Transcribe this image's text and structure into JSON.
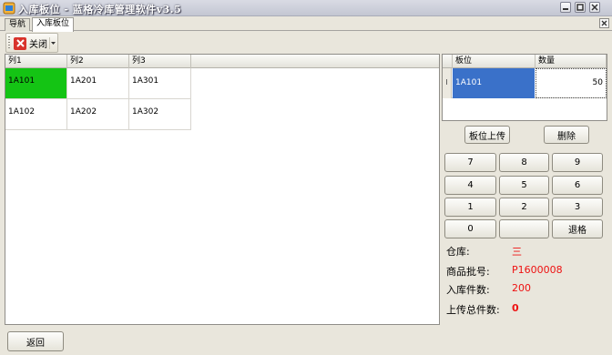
{
  "window": {
    "title": "入库板位 - 蓝格冷库管理软件v3.5"
  },
  "tabs": [
    {
      "label": "导航"
    },
    {
      "label": "入库板位"
    }
  ],
  "toolbar": {
    "close_label": "关闭"
  },
  "left_grid": {
    "headers": [
      "列1",
      "列2",
      "列3"
    ],
    "rows": [
      [
        "1A101",
        "1A201",
        "1A301"
      ],
      [
        "1A102",
        "1A202",
        "1A302"
      ]
    ]
  },
  "right_grid": {
    "headers": [
      "板位",
      "数量"
    ],
    "row": {
      "marker": "I",
      "pallet": "1A101",
      "quantity": "50"
    }
  },
  "actions": {
    "upload": "板位上传",
    "delete": "删除"
  },
  "keypad": {
    "k7": "7",
    "k8": "8",
    "k9": "9",
    "k4": "4",
    "k5": "5",
    "k6": "6",
    "k1": "1",
    "k2": "2",
    "k3": "3",
    "k0": "0",
    "blank": "",
    "backspace": "退格"
  },
  "info": {
    "warehouse_label": "仓库:",
    "warehouse_value": "三",
    "batch_label": "商品批号:",
    "batch_value": "P1600008",
    "count_label": "入库件数:",
    "count_value": "200",
    "uploaded_label": "上传总件数:",
    "uploaded_value": "0"
  },
  "footer": {
    "back_label": "返回"
  },
  "colors": {
    "selected_cell": "#14c414",
    "selected_row": "#3a71c9",
    "value_red": "#ee1111"
  }
}
